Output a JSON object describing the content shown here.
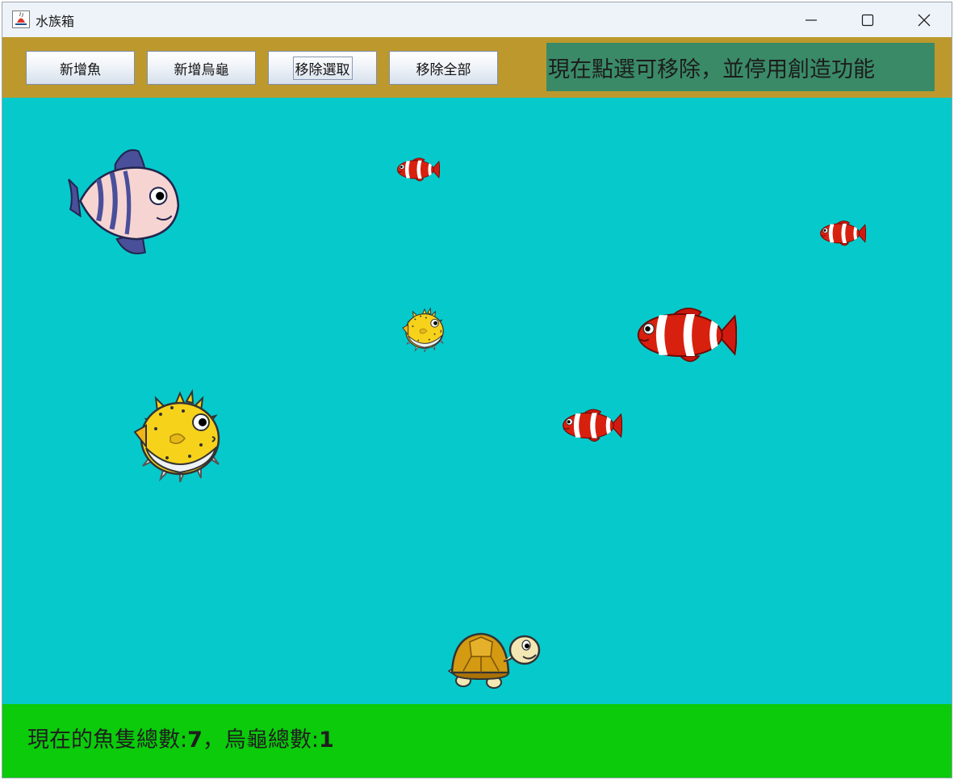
{
  "window": {
    "title": "水族箱",
    "icons": {
      "app": "java-cup-icon",
      "minimize": "minimize-icon",
      "maximize": "maximize-icon",
      "close": "close-icon"
    }
  },
  "toolbar": {
    "add_fish_label": "新增魚",
    "add_turtle_label": "新增烏龜",
    "remove_selected_label": "移除選取",
    "remove_all_label": "移除全部",
    "status_message": "現在點選可移除，並停用創造功能"
  },
  "aquarium": {
    "creatures": [
      {
        "kind": "striped-fish",
        "icon": "striped-fish-icon"
      },
      {
        "kind": "clownfish",
        "icon": "clownfish-icon"
      },
      {
        "kind": "clownfish",
        "icon": "clownfish-icon"
      },
      {
        "kind": "pufferfish",
        "icon": "pufferfish-icon"
      },
      {
        "kind": "clownfish",
        "icon": "clownfish-icon"
      },
      {
        "kind": "pufferfish",
        "icon": "pufferfish-icon"
      },
      {
        "kind": "clownfish",
        "icon": "clownfish-icon"
      },
      {
        "kind": "turtle",
        "icon": "turtle-icon"
      }
    ]
  },
  "footer": {
    "fish_count_label": "現在的魚隻總數:",
    "fish_count": "7",
    "separator": "，",
    "turtle_count_label": "烏龜總數:",
    "turtle_count": "1"
  },
  "colors": {
    "toolbar_bg": "#bd992d",
    "status_bg": "#3a8a67",
    "water": "#06c9cb",
    "footer_bg": "#0bcb0b"
  }
}
